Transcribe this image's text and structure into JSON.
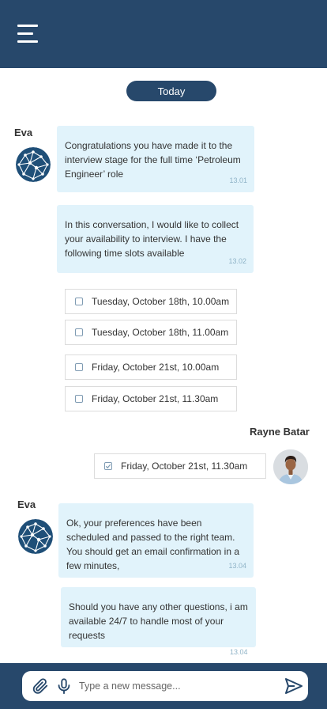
{
  "header": {
    "menu_icon": "hamburger-menu-icon"
  },
  "date_separator": "Today",
  "colors": {
    "header": "#27486b",
    "bubble": "#e1f3fb",
    "timestamp": "#8fb3c7"
  },
  "messages": {
    "bot_name_1": "Eva",
    "msg1": {
      "text": "Congratulations you have made it to the interview stage for the full time ‘Petroleum Engineer’ role",
      "time": "13.01"
    },
    "msg2": {
      "text": "In this conversation, I would like to collect your availability to interview. I have the following time slots available",
      "time": "13.02"
    },
    "slots": [
      {
        "label": "Tuesday, October 18th, 10.00am",
        "checked": false
      },
      {
        "label": "Tuesday, October 18th, 11.00am",
        "checked": false
      },
      {
        "label": "Friday, October 21st, 10.00am",
        "checked": false
      },
      {
        "label": "Friday, October 21st, 11.30am",
        "checked": false
      }
    ],
    "user_name": "Rayne Batar",
    "user_reply": {
      "label": "Friday, October 21st, 11.30am",
      "checked": true
    },
    "bot_name_2": "Eva",
    "msg3": {
      "text": "Ok, your preferences have been scheduled and passed to the right team. You should get an email confirmation in a few minutes,",
      "time": "13.04"
    },
    "msg4": {
      "text": "Should you have any other questions, i am available 24/7 to handle most of your requests",
      "time": "13.04"
    }
  },
  "composer": {
    "placeholder": "Type a new message...",
    "attach_icon": "paperclip-icon",
    "mic_icon": "microphone-icon",
    "send_icon": "send-icon"
  }
}
